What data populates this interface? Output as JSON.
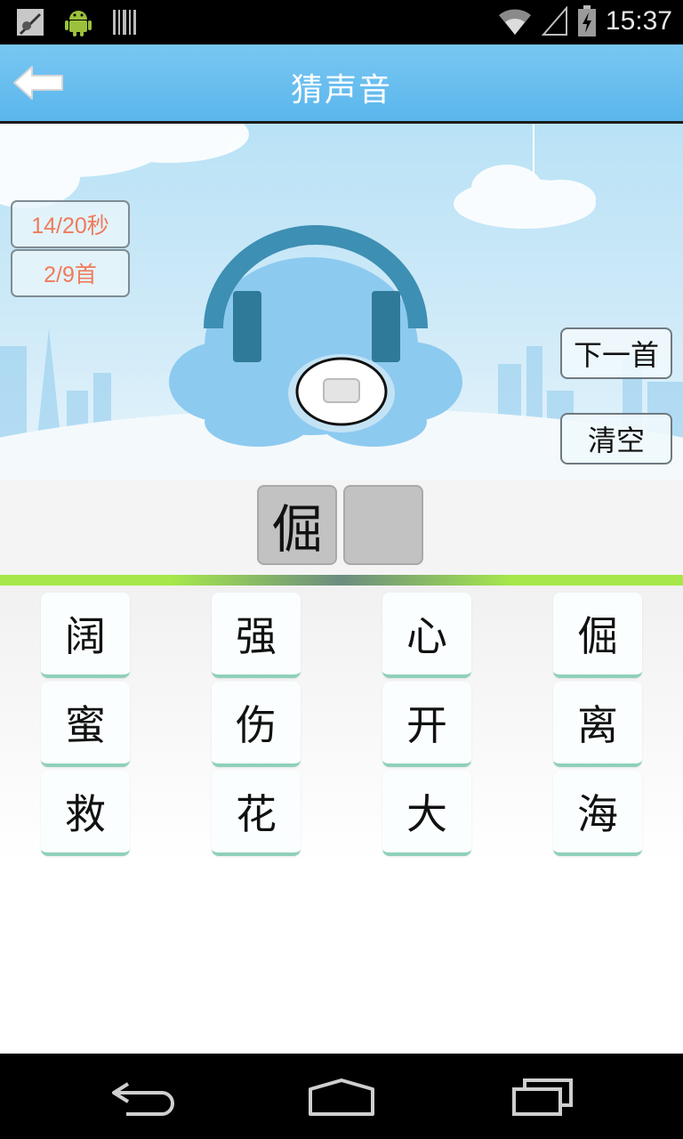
{
  "status_bar": {
    "time": "15:37",
    "left_icons": [
      "screenshot-icon",
      "android-icon",
      "barcode-icon"
    ],
    "right_icons": [
      "wifi-icon",
      "signal-icon",
      "battery-icon"
    ]
  },
  "header": {
    "title": "猜声音",
    "back_icon": "arrow-left-icon"
  },
  "stage": {
    "timer": "14/20秒",
    "progress": "2/9首",
    "next_button": "下一首",
    "clear_button": "清空",
    "play_icon": "play-button-icon"
  },
  "answer": {
    "slots": [
      "倔",
      ""
    ]
  },
  "choices": [
    [
      "阔",
      "强",
      "心",
      "倔"
    ],
    [
      "蜜",
      "伤",
      "开",
      "离"
    ],
    [
      "救",
      "花",
      "大",
      "海"
    ]
  ],
  "nav_bar": {
    "icons": [
      "back-nav-icon",
      "home-nav-icon",
      "recents-nav-icon"
    ]
  },
  "colors": {
    "header": "#5ab6ec",
    "accent_text": "#f07a5a",
    "divider": "#a6e84a",
    "key_border": "#8fd0ba"
  }
}
